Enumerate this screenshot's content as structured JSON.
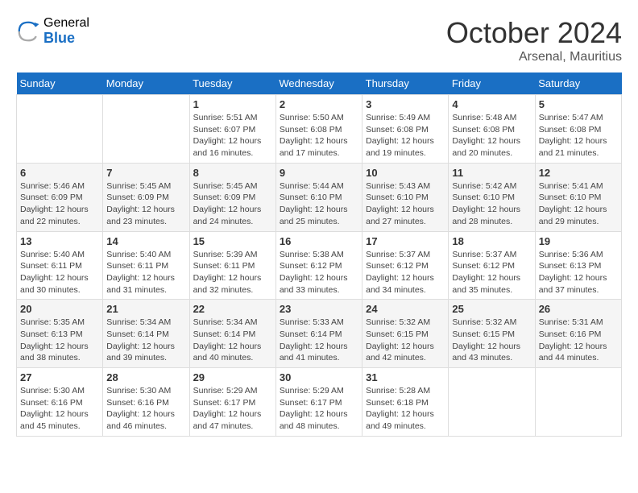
{
  "logo": {
    "general": "General",
    "blue": "Blue"
  },
  "title": "October 2024",
  "location": "Arsenal, Mauritius",
  "weekdays": [
    "Sunday",
    "Monday",
    "Tuesday",
    "Wednesday",
    "Thursday",
    "Friday",
    "Saturday"
  ],
  "weeks": [
    [
      null,
      null,
      {
        "day": "1",
        "sunrise": "Sunrise: 5:51 AM",
        "sunset": "Sunset: 6:07 PM",
        "daylight": "Daylight: 12 hours and 16 minutes."
      },
      {
        "day": "2",
        "sunrise": "Sunrise: 5:50 AM",
        "sunset": "Sunset: 6:08 PM",
        "daylight": "Daylight: 12 hours and 17 minutes."
      },
      {
        "day": "3",
        "sunrise": "Sunrise: 5:49 AM",
        "sunset": "Sunset: 6:08 PM",
        "daylight": "Daylight: 12 hours and 19 minutes."
      },
      {
        "day": "4",
        "sunrise": "Sunrise: 5:48 AM",
        "sunset": "Sunset: 6:08 PM",
        "daylight": "Daylight: 12 hours and 20 minutes."
      },
      {
        "day": "5",
        "sunrise": "Sunrise: 5:47 AM",
        "sunset": "Sunset: 6:08 PM",
        "daylight": "Daylight: 12 hours and 21 minutes."
      }
    ],
    [
      {
        "day": "6",
        "sunrise": "Sunrise: 5:46 AM",
        "sunset": "Sunset: 6:09 PM",
        "daylight": "Daylight: 12 hours and 22 minutes."
      },
      {
        "day": "7",
        "sunrise": "Sunrise: 5:45 AM",
        "sunset": "Sunset: 6:09 PM",
        "daylight": "Daylight: 12 hours and 23 minutes."
      },
      {
        "day": "8",
        "sunrise": "Sunrise: 5:45 AM",
        "sunset": "Sunset: 6:09 PM",
        "daylight": "Daylight: 12 hours and 24 minutes."
      },
      {
        "day": "9",
        "sunrise": "Sunrise: 5:44 AM",
        "sunset": "Sunset: 6:10 PM",
        "daylight": "Daylight: 12 hours and 25 minutes."
      },
      {
        "day": "10",
        "sunrise": "Sunrise: 5:43 AM",
        "sunset": "Sunset: 6:10 PM",
        "daylight": "Daylight: 12 hours and 27 minutes."
      },
      {
        "day": "11",
        "sunrise": "Sunrise: 5:42 AM",
        "sunset": "Sunset: 6:10 PM",
        "daylight": "Daylight: 12 hours and 28 minutes."
      },
      {
        "day": "12",
        "sunrise": "Sunrise: 5:41 AM",
        "sunset": "Sunset: 6:10 PM",
        "daylight": "Daylight: 12 hours and 29 minutes."
      }
    ],
    [
      {
        "day": "13",
        "sunrise": "Sunrise: 5:40 AM",
        "sunset": "Sunset: 6:11 PM",
        "daylight": "Daylight: 12 hours and 30 minutes."
      },
      {
        "day": "14",
        "sunrise": "Sunrise: 5:40 AM",
        "sunset": "Sunset: 6:11 PM",
        "daylight": "Daylight: 12 hours and 31 minutes."
      },
      {
        "day": "15",
        "sunrise": "Sunrise: 5:39 AM",
        "sunset": "Sunset: 6:11 PM",
        "daylight": "Daylight: 12 hours and 32 minutes."
      },
      {
        "day": "16",
        "sunrise": "Sunrise: 5:38 AM",
        "sunset": "Sunset: 6:12 PM",
        "daylight": "Daylight: 12 hours and 33 minutes."
      },
      {
        "day": "17",
        "sunrise": "Sunrise: 5:37 AM",
        "sunset": "Sunset: 6:12 PM",
        "daylight": "Daylight: 12 hours and 34 minutes."
      },
      {
        "day": "18",
        "sunrise": "Sunrise: 5:37 AM",
        "sunset": "Sunset: 6:12 PM",
        "daylight": "Daylight: 12 hours and 35 minutes."
      },
      {
        "day": "19",
        "sunrise": "Sunrise: 5:36 AM",
        "sunset": "Sunset: 6:13 PM",
        "daylight": "Daylight: 12 hours and 37 minutes."
      }
    ],
    [
      {
        "day": "20",
        "sunrise": "Sunrise: 5:35 AM",
        "sunset": "Sunset: 6:13 PM",
        "daylight": "Daylight: 12 hours and 38 minutes."
      },
      {
        "day": "21",
        "sunrise": "Sunrise: 5:34 AM",
        "sunset": "Sunset: 6:14 PM",
        "daylight": "Daylight: 12 hours and 39 minutes."
      },
      {
        "day": "22",
        "sunrise": "Sunrise: 5:34 AM",
        "sunset": "Sunset: 6:14 PM",
        "daylight": "Daylight: 12 hours and 40 minutes."
      },
      {
        "day": "23",
        "sunrise": "Sunrise: 5:33 AM",
        "sunset": "Sunset: 6:14 PM",
        "daylight": "Daylight: 12 hours and 41 minutes."
      },
      {
        "day": "24",
        "sunrise": "Sunrise: 5:32 AM",
        "sunset": "Sunset: 6:15 PM",
        "daylight": "Daylight: 12 hours and 42 minutes."
      },
      {
        "day": "25",
        "sunrise": "Sunrise: 5:32 AM",
        "sunset": "Sunset: 6:15 PM",
        "daylight": "Daylight: 12 hours and 43 minutes."
      },
      {
        "day": "26",
        "sunrise": "Sunrise: 5:31 AM",
        "sunset": "Sunset: 6:16 PM",
        "daylight": "Daylight: 12 hours and 44 minutes."
      }
    ],
    [
      {
        "day": "27",
        "sunrise": "Sunrise: 5:30 AM",
        "sunset": "Sunset: 6:16 PM",
        "daylight": "Daylight: 12 hours and 45 minutes."
      },
      {
        "day": "28",
        "sunrise": "Sunrise: 5:30 AM",
        "sunset": "Sunset: 6:16 PM",
        "daylight": "Daylight: 12 hours and 46 minutes."
      },
      {
        "day": "29",
        "sunrise": "Sunrise: 5:29 AM",
        "sunset": "Sunset: 6:17 PM",
        "daylight": "Daylight: 12 hours and 47 minutes."
      },
      {
        "day": "30",
        "sunrise": "Sunrise: 5:29 AM",
        "sunset": "Sunset: 6:17 PM",
        "daylight": "Daylight: 12 hours and 48 minutes."
      },
      {
        "day": "31",
        "sunrise": "Sunrise: 5:28 AM",
        "sunset": "Sunset: 6:18 PM",
        "daylight": "Daylight: 12 hours and 49 minutes."
      },
      null,
      null
    ]
  ]
}
